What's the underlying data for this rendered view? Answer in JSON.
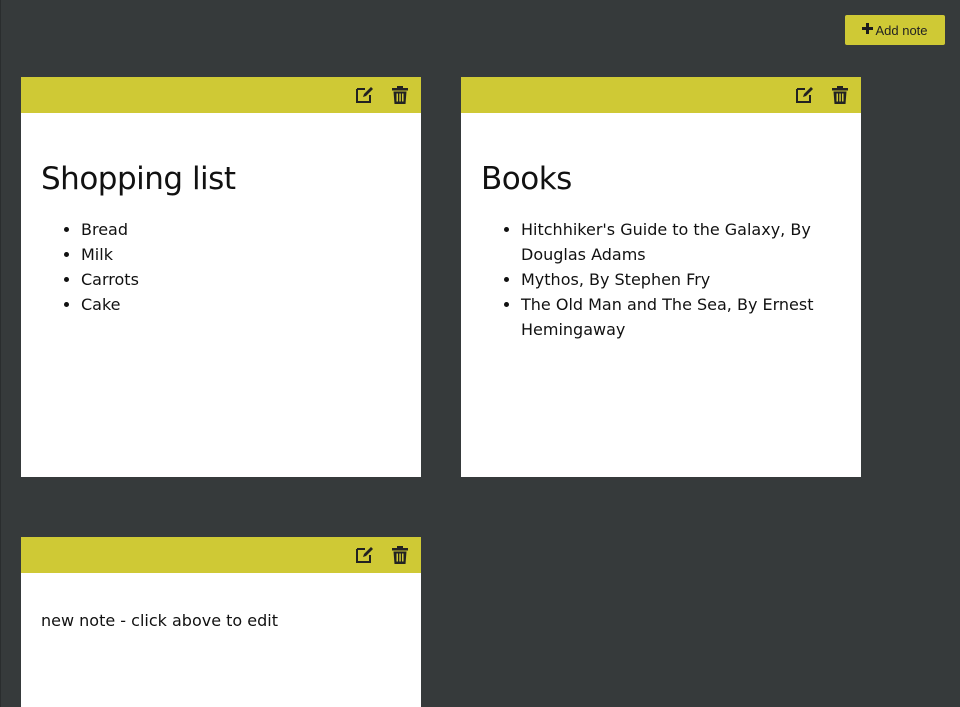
{
  "toolbar": {
    "add_note_label": "Add note"
  },
  "colors": {
    "background": "#363a3b",
    "accent": "#cfc935",
    "note_bg": "#ffffff"
  },
  "notes": [
    {
      "title": "Shopping list",
      "items": [
        "Bread",
        "Milk",
        "Carrots",
        "Cake"
      ]
    },
    {
      "title": "Books",
      "items": [
        "Hitchhiker's Guide to the Galaxy, By Douglas Adams",
        "Mythos, By Stephen Fry",
        "The Old Man and The Sea, By Ernest Hemingaway"
      ]
    },
    {
      "text": "new note - click above to edit"
    }
  ],
  "icons": {
    "add": "plus-icon",
    "edit": "edit-icon",
    "delete": "trash-icon"
  }
}
